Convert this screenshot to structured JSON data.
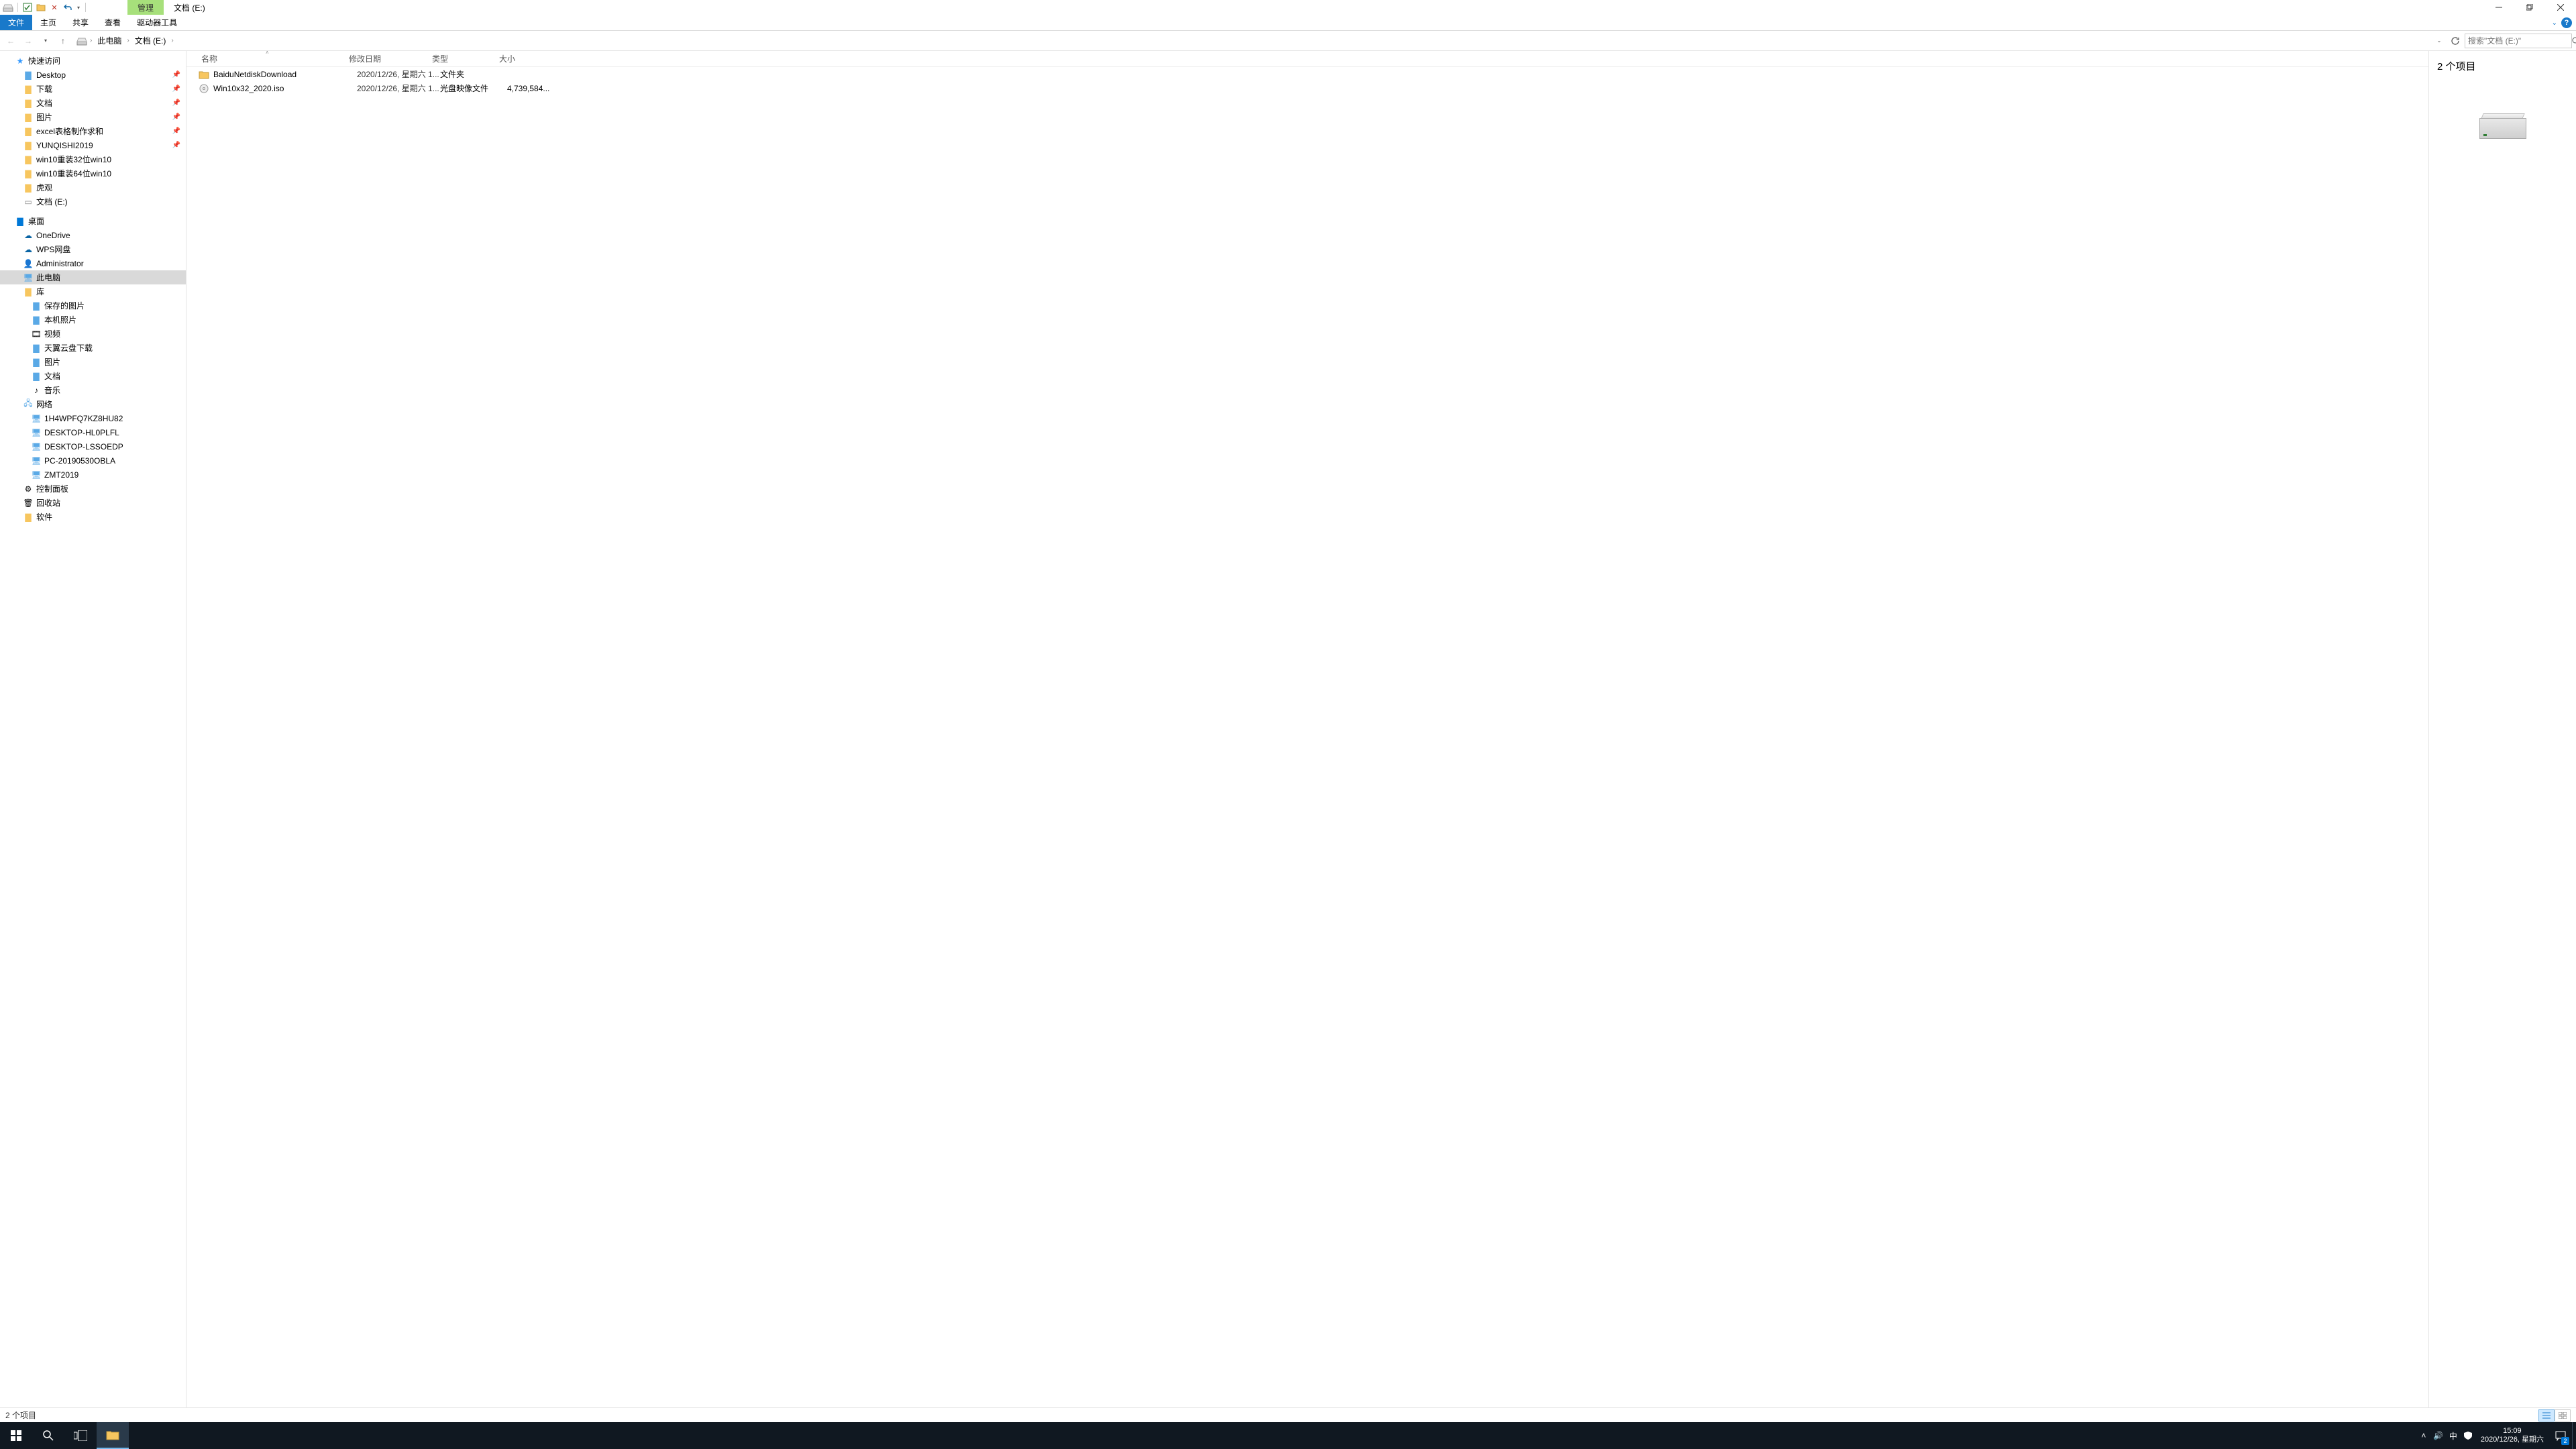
{
  "titlebar": {
    "mgmt_tab": "管理",
    "window_title": "文档 (E:)"
  },
  "ribbon": {
    "file": "文件",
    "home": "主页",
    "share": "共享",
    "view": "查看",
    "drive_tools": "驱动器工具"
  },
  "breadcrumb": {
    "root": "此电脑",
    "current": "文档 (E:)"
  },
  "search": {
    "placeholder": "搜索\"文档 (E:)\""
  },
  "nav": {
    "quick_access": "快速访问",
    "desktop_qa": "Desktop",
    "downloads": "下载",
    "documents": "文档",
    "pictures": "图片",
    "excel": "excel表格制作求和",
    "yunqishi": "YUNQISHI2019",
    "win32": "win10重装32位win10",
    "win64": "win10重装64位win10",
    "huguan": "虎观",
    "edrive": "文档 (E:)",
    "desktop": "桌面",
    "onedrive": "OneDrive",
    "wps": "WPS网盘",
    "admin": "Administrator",
    "this_pc": "此电脑",
    "library": "库",
    "saved_pics": "保存的图片",
    "local_photos": "本机照片",
    "video": "视频",
    "tianyi": "天翼云盘下载",
    "pics_lib": "图片",
    "docs_lib": "文档",
    "music": "音乐",
    "network": "网络",
    "pc1": "1H4WPFQ7KZ8HU82",
    "pc2": "DESKTOP-HL0PLFL",
    "pc3": "DESKTOP-LSSOEDP",
    "pc4": "PC-20190530OBLA",
    "pc5": "ZMT2019",
    "control_panel": "控制面板",
    "recycle": "回收站",
    "software": "软件"
  },
  "columns": {
    "name": "名称",
    "date": "修改日期",
    "type": "类型",
    "size": "大小"
  },
  "rows": [
    {
      "name": "BaiduNetdiskDownload",
      "date": "2020/12/26, 星期六 1...",
      "type": "文件夹",
      "size": "",
      "icon": "folder"
    },
    {
      "name": "Win10x32_2020.iso",
      "date": "2020/12/26, 星期六 1...",
      "type": "光盘映像文件",
      "size": "4,739,584...",
      "icon": "disc"
    }
  ],
  "preview": {
    "item_count": "2 个项目"
  },
  "statusbar": {
    "text": "2 个项目"
  },
  "taskbar": {
    "time": "15:09",
    "date": "2020/12/26, 星期六",
    "ime": "中",
    "action_badge": "2"
  }
}
